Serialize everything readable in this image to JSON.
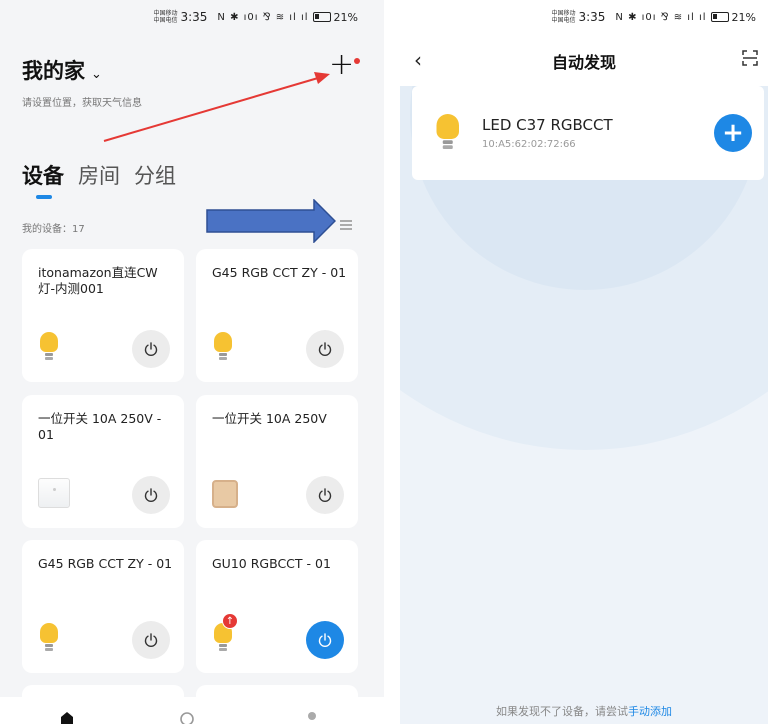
{
  "left_screen": {
    "status_bar": {
      "carrier_top": "中国移动",
      "carrier_bottom": "中国电信",
      "time": "3:35",
      "icons": "N ✱ ı0ı ⅋ ≋ ıl ıl",
      "battery": "21%"
    },
    "home": {
      "title": "我的家",
      "chevron": "⌄",
      "weather_hint": "请设置位置，获取天气信息",
      "add_glyph": "+"
    },
    "tabs": [
      "设备",
      "房间",
      "分组"
    ],
    "device_count_label": "我的设备：17",
    "devices": [
      {
        "name": "itonamazon直连CW灯-内测001",
        "icon": "bulb-icon",
        "power_on": false
      },
      {
        "name": "G45  RGB CCT ZY - 01",
        "icon": "bulb-icon",
        "power_on": false
      },
      {
        "name": "一位开关 10A 250V - 01",
        "icon": "switch-icon",
        "power_on": false
      },
      {
        "name": "一位开关 10A 250V",
        "icon": "switch-icon",
        "power_on": false
      },
      {
        "name": "G45 RGB CCT ZY - 01",
        "icon": "bulb-icon",
        "power_on": false
      },
      {
        "name": "GU10 RGBCCT - 01",
        "icon": "bulb-icon",
        "power_on": true,
        "update_badge": "↑"
      }
    ]
  },
  "right_screen": {
    "status_bar": {
      "carrier_top": "中国移动",
      "carrier_bottom": "中国电信",
      "time": "3:35",
      "icons": "N ✱ ı0ı ⅋ ≋ ıl ıl",
      "battery": "21%"
    },
    "nav": {
      "back_glyph": "‹",
      "title": "自动发现"
    },
    "found_device": {
      "name": "LED C37 RGBCCT",
      "mac": "10:A5:62:02:72:66",
      "add_glyph": "+"
    },
    "hint": {
      "text": "如果发现不了设备，请尝试",
      "link": "手动添加"
    }
  },
  "colors": {
    "accent": "#1e88e5",
    "annotation_red": "#e53935",
    "bulb_yellow": "#f6c232",
    "card_bg": "#ffffff",
    "page_bg": "#f4f5f7"
  }
}
